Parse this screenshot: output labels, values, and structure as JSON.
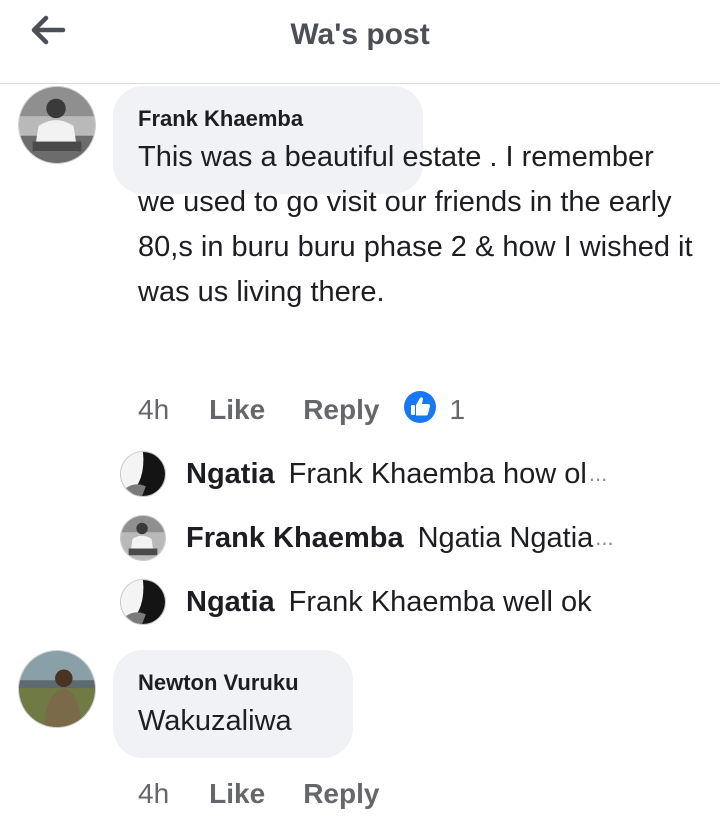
{
  "header": {
    "title": "Wa's post"
  },
  "comments": [
    {
      "name": "Frank Khaemba",
      "text": "This was a beautiful estate . I remember we used to go visit our friends in the early 80,s in buru buru phase 2 & how I wished it was us living there.",
      "time": "4h",
      "like_label": "Like",
      "reply_label": "Reply",
      "reaction_count": "1",
      "replies": [
        {
          "name": "Ngatia",
          "text": "Frank Khaemba how ol",
          "ellipsis": "..."
        },
        {
          "name": "Frank Khaemba",
          "text": "Ngatia Ngatia ",
          "ellipsis": "..."
        },
        {
          "name": "Ngatia",
          "text": "Frank Khaemba well ok",
          "ellipsis": ""
        }
      ]
    },
    {
      "name": "Newton Vuruku",
      "text": "Wakuzaliwa",
      "time": "4h",
      "like_label": "Like",
      "reply_label": "Reply"
    }
  ],
  "colors": {
    "bubble": "#f0f2f5",
    "meta_text": "#65676b",
    "like_blue": "#1877f2"
  },
  "icons": {
    "back": "arrow-left-icon",
    "reaction": "thumbs-up-icon"
  }
}
